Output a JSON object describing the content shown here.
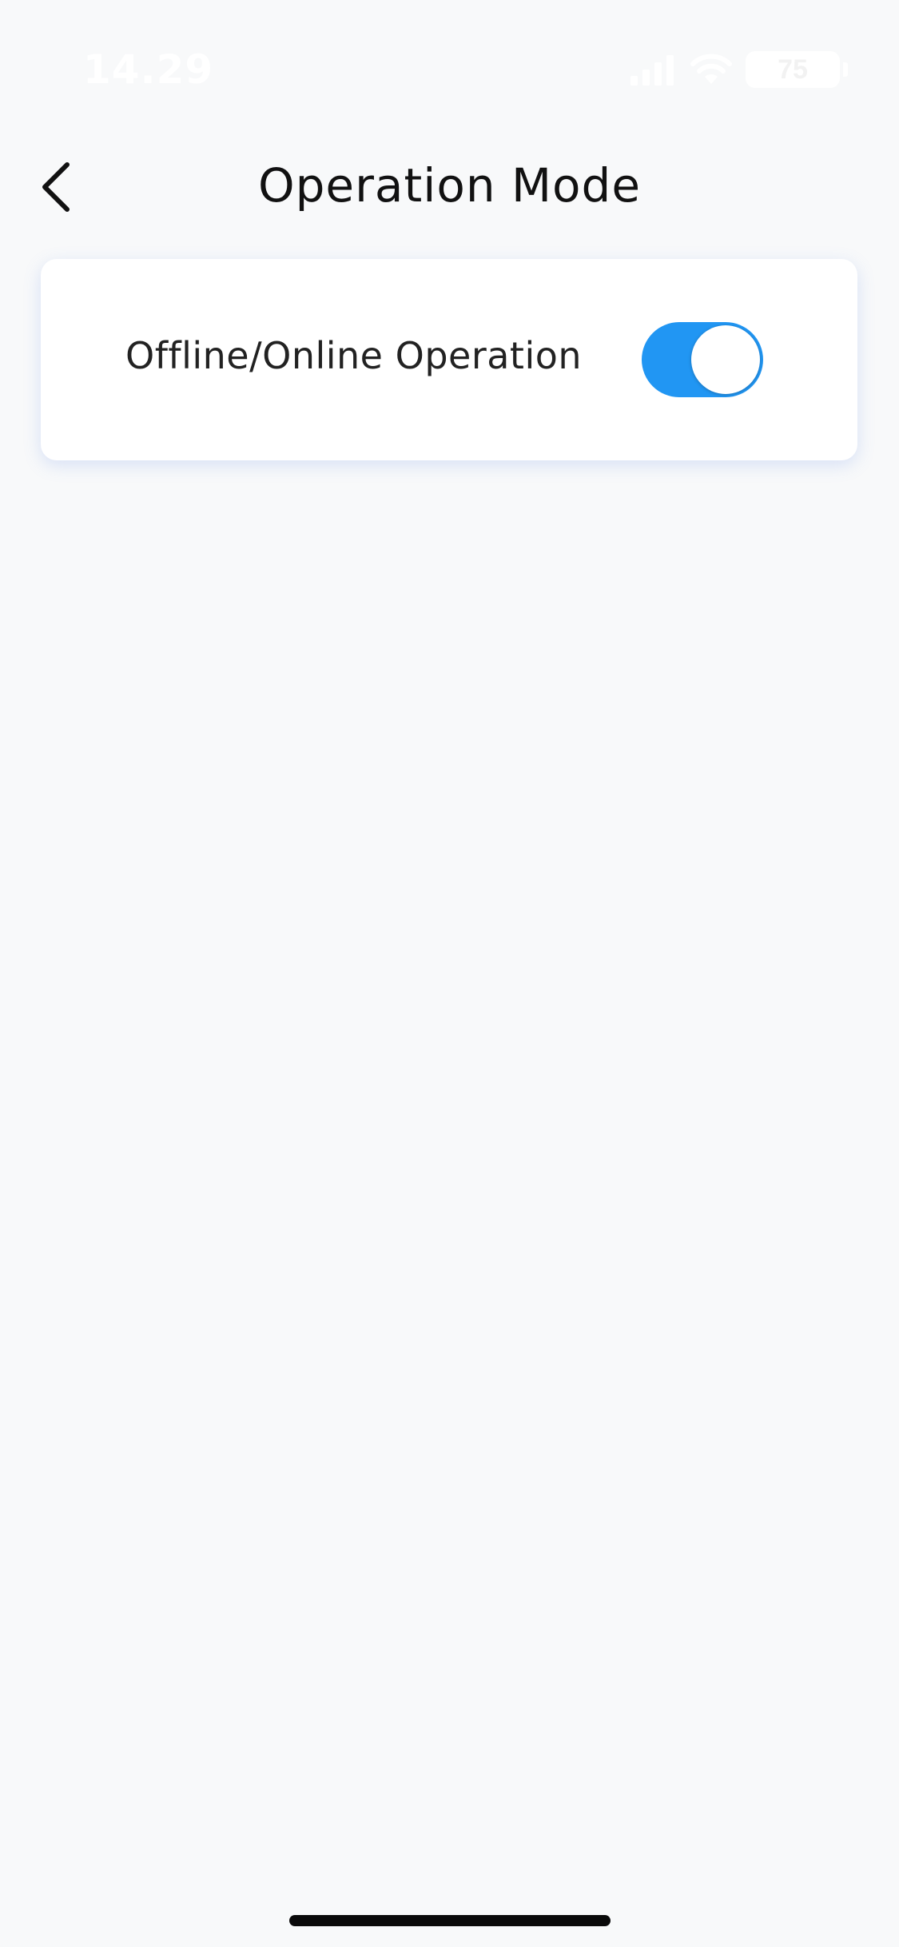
{
  "status_bar": {
    "time": "14.29",
    "battery_level": "75",
    "icons": [
      "signal-icon",
      "wifi-icon",
      "battery-icon"
    ]
  },
  "nav": {
    "back_icon": "chevron-left-icon",
    "title": "Operation Mode"
  },
  "settings": {
    "offline_online": {
      "label": "Offline/Online Operation",
      "enabled": true
    }
  },
  "colors": {
    "accent": "#2196f3",
    "background": "#f8f9fa",
    "card": "#ffffff",
    "text": "#111111"
  }
}
